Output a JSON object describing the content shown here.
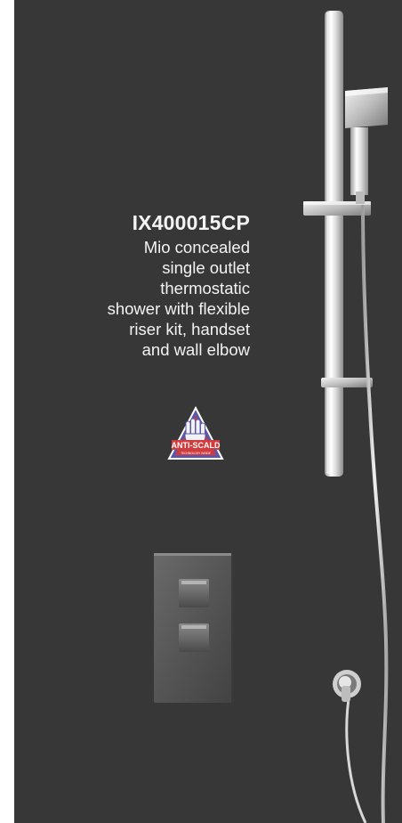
{
  "product": {
    "code": "IX400015CP",
    "description": "Mio concealed\nsingle outlet\nthermostatic\nshower with flexible\nriser kit, handset\nand wall elbow"
  },
  "badge": {
    "label": "ANTI-SCALD",
    "sublabel": "TECHNOLOGY INSIDE",
    "colors": {
      "outer": "#5b57a6",
      "inner": "#d13b3b",
      "outline": "#ffffff"
    }
  },
  "illustration": {
    "items": [
      "riser-rail",
      "square-handset",
      "slider-bracket",
      "flexible-hose",
      "wall-elbow",
      "thermostatic-valve-plate"
    ]
  }
}
